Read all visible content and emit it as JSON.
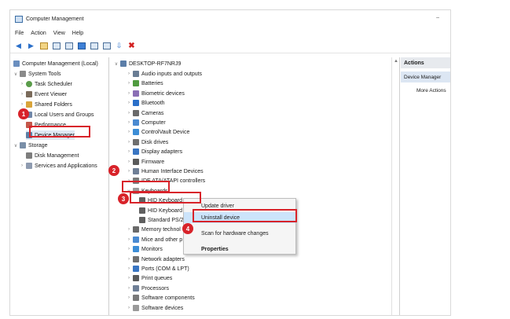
{
  "window": {
    "title": "Computer Management",
    "minimize": "–"
  },
  "menu": [
    "File",
    "Action",
    "View",
    "Help"
  ],
  "left_tree": {
    "root": "Computer Management (Local)",
    "system_tools": "System Tools",
    "task_scheduler": "Task Scheduler",
    "event_viewer": "Event Viewer",
    "shared_folders": "Shared Folders",
    "local_users": "Local Users and Groups",
    "performance": "Performance",
    "device_manager": "Device Manager",
    "storage": "Storage",
    "disk_management": "Disk Management",
    "services": "Services and Applications"
  },
  "device_tree": {
    "computer": "DESKTOP-RF7NRJ9",
    "items": [
      "Audio inputs and outputs",
      "Batteries",
      "Biometric devices",
      "Bluetooth",
      "Cameras",
      "Computer",
      "ControlVault Device",
      "Disk drives",
      "Display adapters",
      "Firmware",
      "Human Interface Devices",
      "IDE ATA/ATAPI controllers",
      "Keyboards"
    ],
    "keyboard_children": [
      "HID Keyboard",
      "HID Keyboard",
      "Standard PS/2"
    ],
    "items_after": [
      "Memory technol",
      "Mice and other p",
      "Monitors",
      "Network adapters",
      "Ports (COM & LPT)",
      "Print queues",
      "Processors",
      "Software components",
      "Software devices"
    ]
  },
  "context_menu": {
    "update_driver": "Update driver",
    "uninstall_device": "Uninstall device",
    "scan_hardware": "Scan for hardware changes",
    "properties": "Properties"
  },
  "actions": {
    "header": "Actions",
    "section": "Device Manager",
    "more": "More Actions"
  },
  "callouts": [
    "1",
    "2",
    "3",
    "4"
  ],
  "colors": {
    "highlight": "#d8232a",
    "selection": "#cce4fb",
    "accent": "#2a6fc9"
  },
  "icons": {
    "back": "arrow-left-icon",
    "forward": "arrow-right-icon",
    "delete": "x-icon",
    "expand": "chevron-right-icon",
    "collapse": "chevron-down-icon"
  }
}
